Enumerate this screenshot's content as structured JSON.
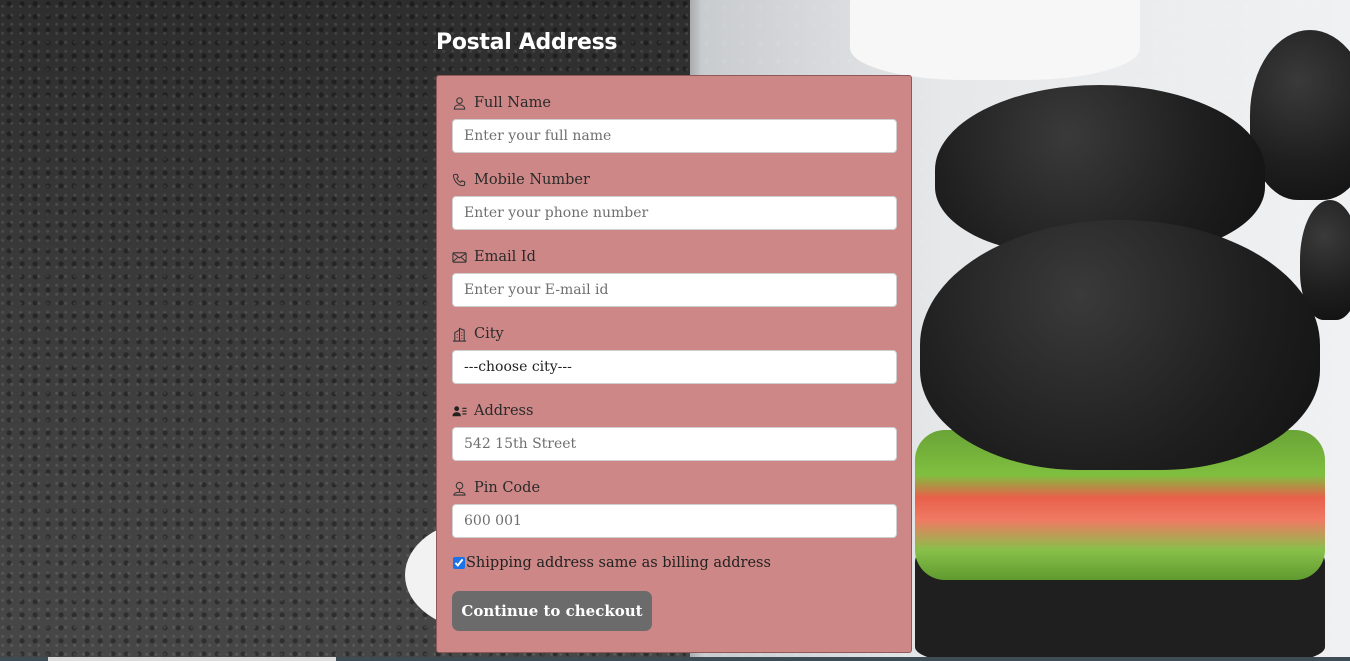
{
  "page": {
    "title": "Postal Address"
  },
  "form": {
    "fields": [
      {
        "label": "Full Name",
        "icon": "person-icon",
        "placeholder": "Enter your full name",
        "value": ""
      },
      {
        "label": "Mobile Number",
        "icon": "phone-icon",
        "placeholder": "Enter your phone number",
        "value": ""
      },
      {
        "label": "Email Id",
        "icon": "envelope-icon",
        "placeholder": "Enter your E-mail id",
        "value": ""
      },
      {
        "label": "City",
        "icon": "building-icon",
        "selected": "---choose city---"
      },
      {
        "label": "Address",
        "icon": "address-card-icon",
        "placeholder": "542 15th Street",
        "value": ""
      },
      {
        "label": "Pin Code",
        "icon": "location-person-icon",
        "placeholder": "600 001",
        "value": ""
      }
    ],
    "shipping_same": {
      "label": "Shipping address same as billing address",
      "checked": true
    },
    "submit_label": "Continue to checkout"
  },
  "colors": {
    "card": "#cd8787",
    "button": "#6b6b6b",
    "title": "#ffffff"
  }
}
